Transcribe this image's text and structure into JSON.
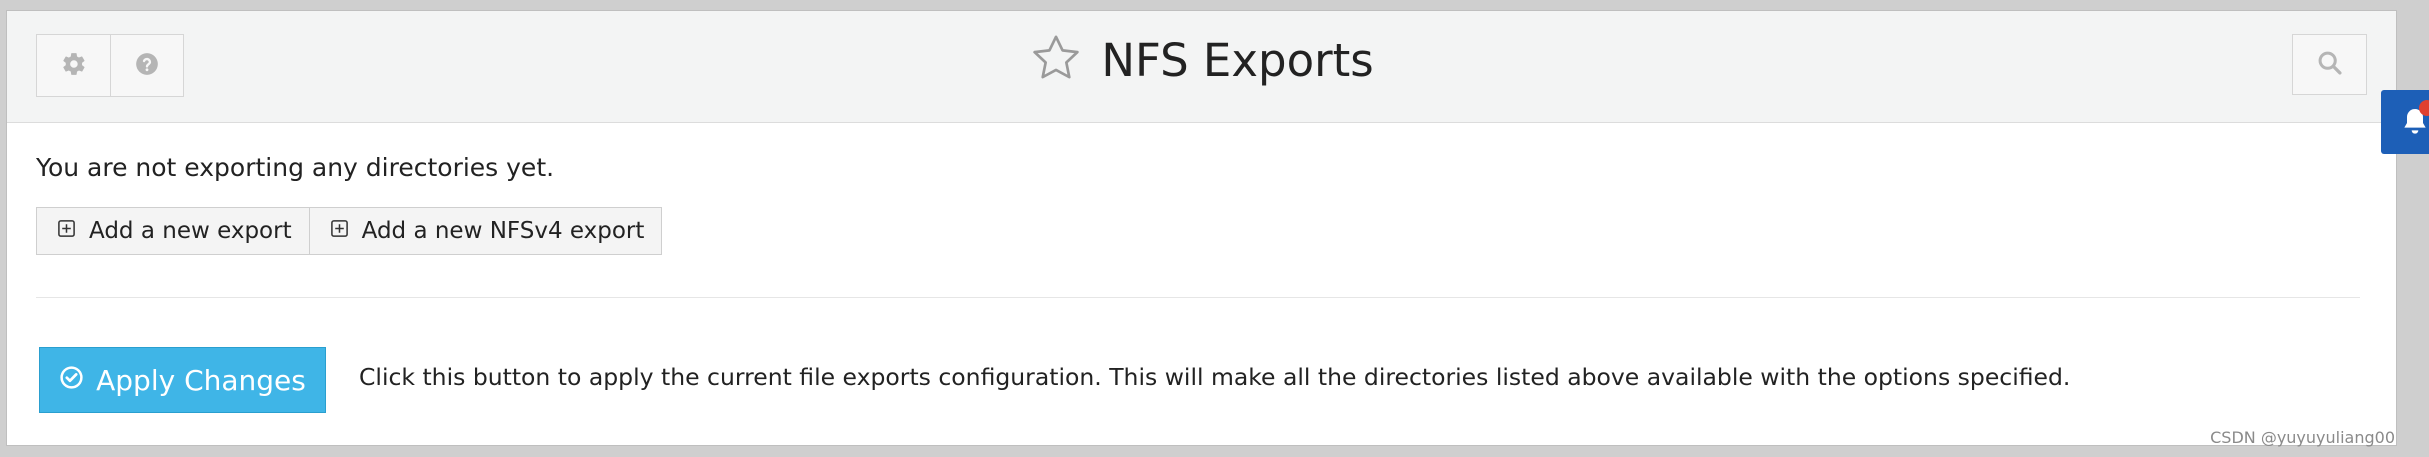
{
  "header": {
    "title": "NFS Exports",
    "icons": {
      "settings": "gear-icon",
      "help": "help-icon",
      "favorite": "star-icon",
      "search": "search-icon"
    }
  },
  "notifications": {
    "icon": "bell-icon",
    "badge_color": "#e0402f",
    "tab_color": "#1d5fb7"
  },
  "main": {
    "empty_message": "You are not exporting any directories yet.",
    "add_buttons": [
      {
        "label": "Add a new export",
        "icon": "plus-square-icon"
      },
      {
        "label": "Add a new NFSv4 export",
        "icon": "plus-square-icon"
      }
    ],
    "apply": {
      "label": "Apply Changes",
      "icon": "check-circle-icon",
      "color": "#3fb5e7",
      "description": "Click this button to apply the current file exports configuration. This will make all the directories listed above available with the options specified."
    }
  },
  "watermark": "CSDN @yuyuyuliang00"
}
